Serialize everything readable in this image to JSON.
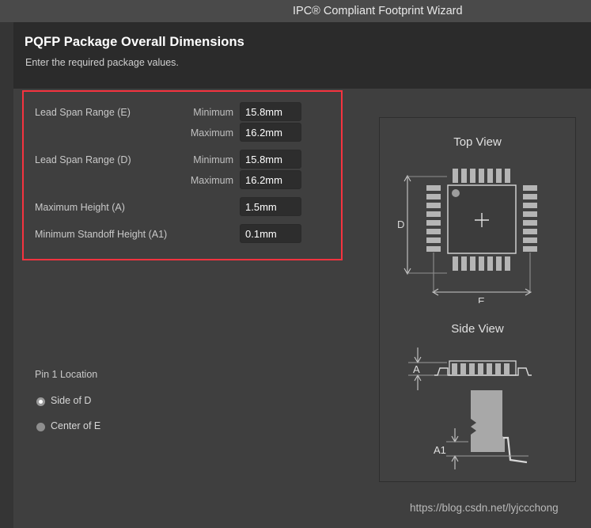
{
  "window": {
    "title": "IPC® Compliant Footprint Wizard"
  },
  "header": {
    "title": "PQFP Package Overall Dimensions",
    "subtitle": "Enter the required package values."
  },
  "form": {
    "rows": [
      {
        "label": "Lead Span Range (E)",
        "fields": [
          {
            "sub_label": "Minimum",
            "value": "15.8mm",
            "placeholder": ""
          },
          {
            "sub_label": "Maximum",
            "value": "16.2mm",
            "placeholder": ""
          }
        ]
      },
      {
        "label": "Lead Span Range (D)",
        "fields": [
          {
            "sub_label": "Minimum",
            "value": "15.8mm",
            "placeholder": ""
          },
          {
            "sub_label": "Maximum",
            "value": "16.2mm",
            "placeholder": ""
          }
        ]
      },
      {
        "label": "Maximum Height (A)",
        "fields": [
          {
            "sub_label": "",
            "value": "1.5mm",
            "placeholder": ""
          }
        ]
      },
      {
        "label": "Minimum Standoff Height (A1)",
        "fields": [
          {
            "sub_label": "",
            "value": "0.1mm",
            "placeholder": ""
          }
        ]
      }
    ]
  },
  "pin1": {
    "title": "Pin 1 Location",
    "options": [
      {
        "label": "Side of D",
        "selected": true
      },
      {
        "label": "Center of E",
        "selected": false
      }
    ]
  },
  "diagram": {
    "top_view_title": "Top View",
    "side_view_title": "Side View",
    "labels": {
      "d": "D",
      "e": "E",
      "a": "A",
      "a1": "A1"
    }
  },
  "watermark": {
    "text": "https://blog.csdn.net/lyjccchong"
  },
  "colors": {
    "titlebar": "#4a4a4a",
    "header_band": "#2b2b2b",
    "body": "#3f3f3f",
    "left_strip": "#353535",
    "highlight": "#f5333f",
    "input_bg": "#2d2d2d",
    "panel_bg": "#414141",
    "lead": "#b0b0b0",
    "text": "#c9c9c9"
  }
}
